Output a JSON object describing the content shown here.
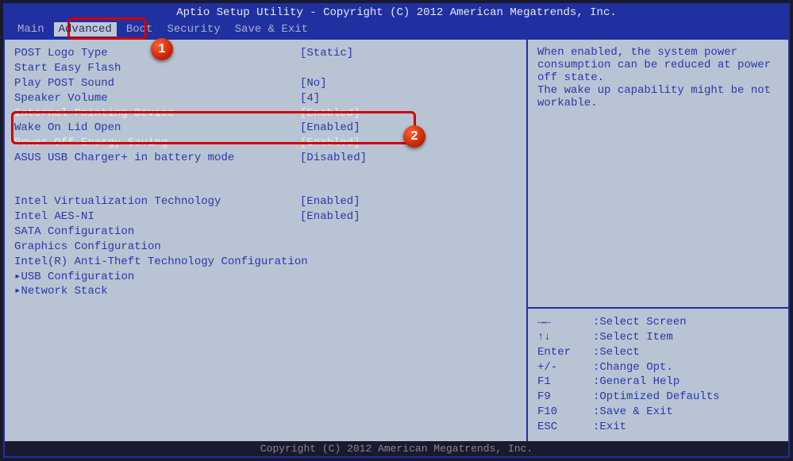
{
  "header": {
    "title": "Aptio Setup Utility - Copyright (C) 2012 American Megatrends, Inc."
  },
  "menu": {
    "items": [
      {
        "label": "Main",
        "active": false
      },
      {
        "label": "Advanced",
        "active": true
      },
      {
        "label": "Boot",
        "active": false
      },
      {
        "label": "Security",
        "active": false
      },
      {
        "label": "Save & Exit",
        "active": false
      }
    ]
  },
  "settings": [
    {
      "label": "POST Logo Type",
      "value": "[Static]"
    },
    {
      "label": "Start Easy Flash",
      "value": ""
    },
    {
      "label": "Play POST Sound",
      "value": "[No]"
    },
    {
      "label": "Speaker Volume",
      "value": "[4]"
    },
    {
      "label": "Internal Pointing Device",
      "value": "[Enabled]",
      "selected": true
    },
    {
      "label": "Wake On Lid Open",
      "value": "[Enabled]"
    },
    {
      "label": "Power Off Energy Saving",
      "value": "[Enabled]",
      "selected": true
    },
    {
      "label": "ASUS USB Charger+ in battery mode",
      "value": "[Disabled]"
    }
  ],
  "settings2": [
    {
      "label": "Intel Virtualization Technology",
      "value": "[Enabled]"
    },
    {
      "label": "Intel AES-NI",
      "value": "[Enabled]"
    },
    {
      "label": "SATA Configuration",
      "value": ""
    },
    {
      "label": "Graphics Configuration",
      "value": ""
    },
    {
      "label": "Intel(R) Anti-Theft Technology Configuration",
      "value": ""
    },
    {
      "label": "USB Configuration",
      "value": "",
      "prefix": "▸ "
    },
    {
      "label": "Network Stack",
      "value": "",
      "prefix": "▸ "
    }
  ],
  "help": {
    "text": "When enabled, the system power consumption can be reduced at power off state.\nThe wake up capability might be not workable."
  },
  "nav": [
    {
      "key": "→←",
      "sep": ": ",
      "desc": "Select Screen"
    },
    {
      "key": "↑↓",
      "sep": ": ",
      "desc": "Select Item"
    },
    {
      "key": "Enter",
      "sep": ": ",
      "desc": "Select"
    },
    {
      "key": "+/-",
      "sep": ": ",
      "desc": "Change Opt."
    },
    {
      "key": "F1",
      "sep": ": ",
      "desc": "General Help"
    },
    {
      "key": "F9",
      "sep": ": ",
      "desc": "Optimized Defaults"
    },
    {
      "key": "F10",
      "sep": ": ",
      "desc": "Save & Exit"
    },
    {
      "key": "ESC",
      "sep": ": ",
      "desc": "Exit"
    }
  ],
  "footer": {
    "text": "Copyright (C) 2012 American Megatrends, Inc."
  },
  "callouts": {
    "one": "1",
    "two": "2"
  }
}
